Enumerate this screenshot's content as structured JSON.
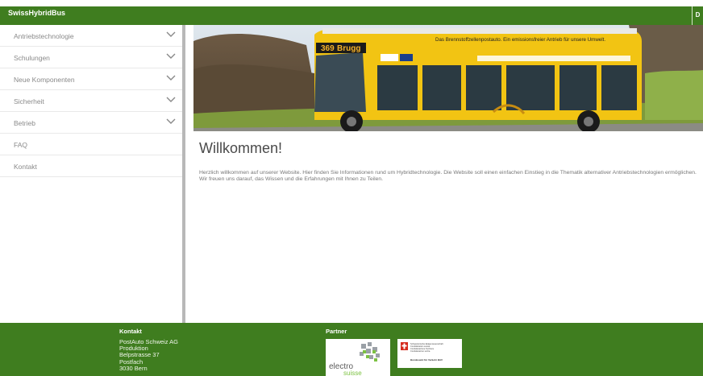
{
  "header": {
    "brand": "SwissHybridBus",
    "right_button": "D"
  },
  "sidebar": {
    "items": [
      {
        "label": "Antriebstechnologie",
        "has_submenu": true
      },
      {
        "label": "Schulungen",
        "has_submenu": true
      },
      {
        "label": "Neue Komponenten",
        "has_submenu": true
      },
      {
        "label": "Sicherheit",
        "has_submenu": true
      },
      {
        "label": "Betrieb",
        "has_submenu": true
      },
      {
        "label": "FAQ",
        "has_submenu": false
      },
      {
        "label": "Kontakt",
        "has_submenu": false
      }
    ]
  },
  "hero": {
    "route_number": "369",
    "destination": "Brugg",
    "side_slogan": "Das Brennstoffzellenpostauto. Ein emissionsfreier Antrieb für unsere Umwelt."
  },
  "main": {
    "title": "Willkommen!",
    "intro": "Herzlich willkommen auf unserer Website. Hier finden Sie Informationen rund um Hybridtechnologie. Die Website soll einen einfachen Einstieg in die Thematik alternativer Antriebstechnologien ermöglichen. Wir freuen uns darauf, das Wissen und die Erfahrungen mit Ihnen zu Teilen."
  },
  "footer": {
    "contact_title": "Kontakt",
    "contact_lines": [
      "PostAuto Schweiz AG",
      "Produktion",
      "Belpstrasse 37",
      "Postfach",
      "3030 Bern"
    ],
    "partner_title": "Partner",
    "partner_logo_1": {
      "line1": "electro",
      "line2": "suisse"
    },
    "partner_logo_2": {
      "lines": [
        "Schweizerische Eidgenossenschaft",
        "Confédération suisse",
        "Confederazione Svizzera",
        "Confederaziun svizra"
      ],
      "office": "Bundesamt für Verkehr BAV"
    }
  },
  "colors": {
    "brand_green": "#3f7d1f",
    "bus_yellow": "#f2c413",
    "sidebar_divider": "#b8b8b8"
  },
  "icons": {
    "submenu": "chevron-down-icon"
  }
}
